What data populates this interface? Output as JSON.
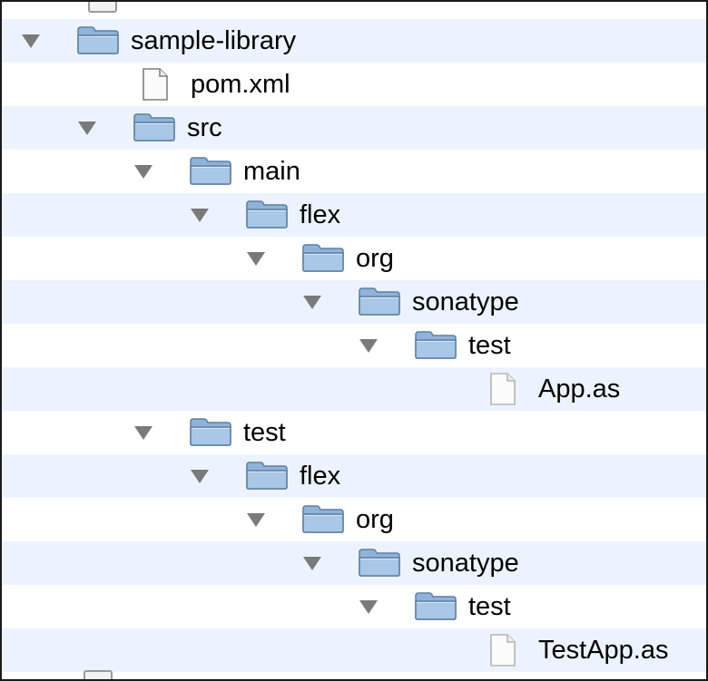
{
  "tree": {
    "rows": [
      {
        "label": "sample-library",
        "type": "folder",
        "depth": 0,
        "expanded": true,
        "icon": "folder-icon"
      },
      {
        "label": "pom.xml",
        "type": "file",
        "depth": 1,
        "expanded": false,
        "icon": "file-icon"
      },
      {
        "label": "src",
        "type": "folder",
        "depth": 1,
        "expanded": true,
        "icon": "folder-icon"
      },
      {
        "label": "main",
        "type": "folder",
        "depth": 2,
        "expanded": true,
        "icon": "folder-icon"
      },
      {
        "label": "flex",
        "type": "folder",
        "depth": 3,
        "expanded": true,
        "icon": "folder-icon"
      },
      {
        "label": "org",
        "type": "folder",
        "depth": 4,
        "expanded": true,
        "icon": "folder-icon"
      },
      {
        "label": "sonatype",
        "type": "folder",
        "depth": 5,
        "expanded": true,
        "icon": "folder-icon"
      },
      {
        "label": "test",
        "type": "folder",
        "depth": 6,
        "expanded": true,
        "icon": "folder-icon"
      },
      {
        "label": "App.as",
        "type": "file",
        "depth": 7,
        "expanded": false,
        "icon": "file-icon"
      },
      {
        "label": "test",
        "type": "folder",
        "depth": 2,
        "expanded": true,
        "icon": "folder-icon"
      },
      {
        "label": "flex",
        "type": "folder",
        "depth": 3,
        "expanded": true,
        "icon": "folder-icon"
      },
      {
        "label": "org",
        "type": "folder",
        "depth": 4,
        "expanded": true,
        "icon": "folder-icon"
      },
      {
        "label": "sonatype",
        "type": "folder",
        "depth": 5,
        "expanded": true,
        "icon": "folder-icon"
      },
      {
        "label": "test",
        "type": "folder",
        "depth": 6,
        "expanded": true,
        "icon": "folder-icon"
      },
      {
        "label": "TestApp.as",
        "type": "file",
        "depth": 7,
        "expanded": false,
        "icon": "file-icon"
      }
    ]
  },
  "colors": {
    "row_stripe": "#edf3fe",
    "disclosure": "#7a7a7a",
    "folder_fill": "#8fb3d9",
    "folder_stroke": "#5d7fa3"
  }
}
